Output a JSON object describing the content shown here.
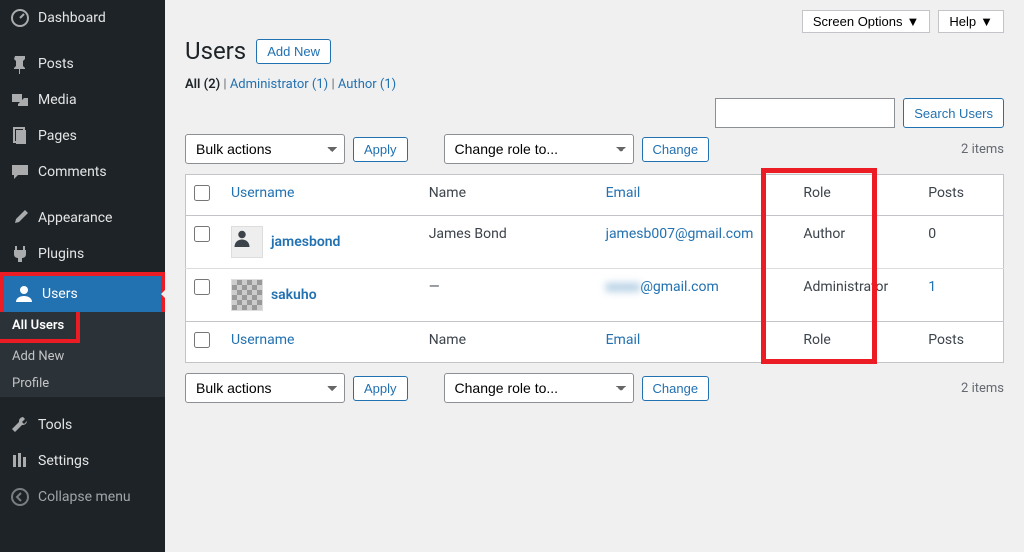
{
  "sidebar": {
    "items": [
      {
        "label": "Dashboard",
        "icon": "dashboard-icon"
      },
      {
        "label": "Posts",
        "icon": "pin-icon"
      },
      {
        "label": "Media",
        "icon": "media-icon"
      },
      {
        "label": "Pages",
        "icon": "pages-icon"
      },
      {
        "label": "Comments",
        "icon": "comments-icon"
      },
      {
        "label": "Appearance",
        "icon": "brush-icon"
      },
      {
        "label": "Plugins",
        "icon": "plugin-icon"
      },
      {
        "label": "Users",
        "icon": "user-icon"
      },
      {
        "label": "Tools",
        "icon": "tools-icon"
      },
      {
        "label": "Settings",
        "icon": "settings-icon"
      }
    ],
    "submenu": {
      "all_users": "All Users",
      "add_new": "Add New",
      "profile": "Profile"
    },
    "collapse": "Collapse menu"
  },
  "topbar": {
    "screen_options": "Screen Options",
    "help": "Help"
  },
  "page": {
    "title": "Users",
    "add_new": "Add New"
  },
  "filters": {
    "all_label": "All",
    "all_count": "(2)",
    "admin_label": "Administrator",
    "admin_count": "(1)",
    "author_label": "Author",
    "author_count": "(1)",
    "separator": " | "
  },
  "search": {
    "button": "Search Users"
  },
  "actions": {
    "bulk": "Bulk actions",
    "apply": "Apply",
    "change_role": "Change role to...",
    "change": "Change",
    "items": "2 items"
  },
  "table": {
    "headers": {
      "username": "Username",
      "name": "Name",
      "email": "Email",
      "role": "Role",
      "posts": "Posts"
    },
    "rows": [
      {
        "username": "jamesbond",
        "name": "James Bond",
        "email": "jamesb007@gmail.com",
        "role": "Author",
        "posts": "0",
        "avatar": "blank"
      },
      {
        "username": "sakuho",
        "name": "—",
        "email_blur": "xxxxx",
        "email_suffix": "@gmail.com",
        "role": "Administrator",
        "posts": "1",
        "avatar": "pix"
      }
    ]
  }
}
